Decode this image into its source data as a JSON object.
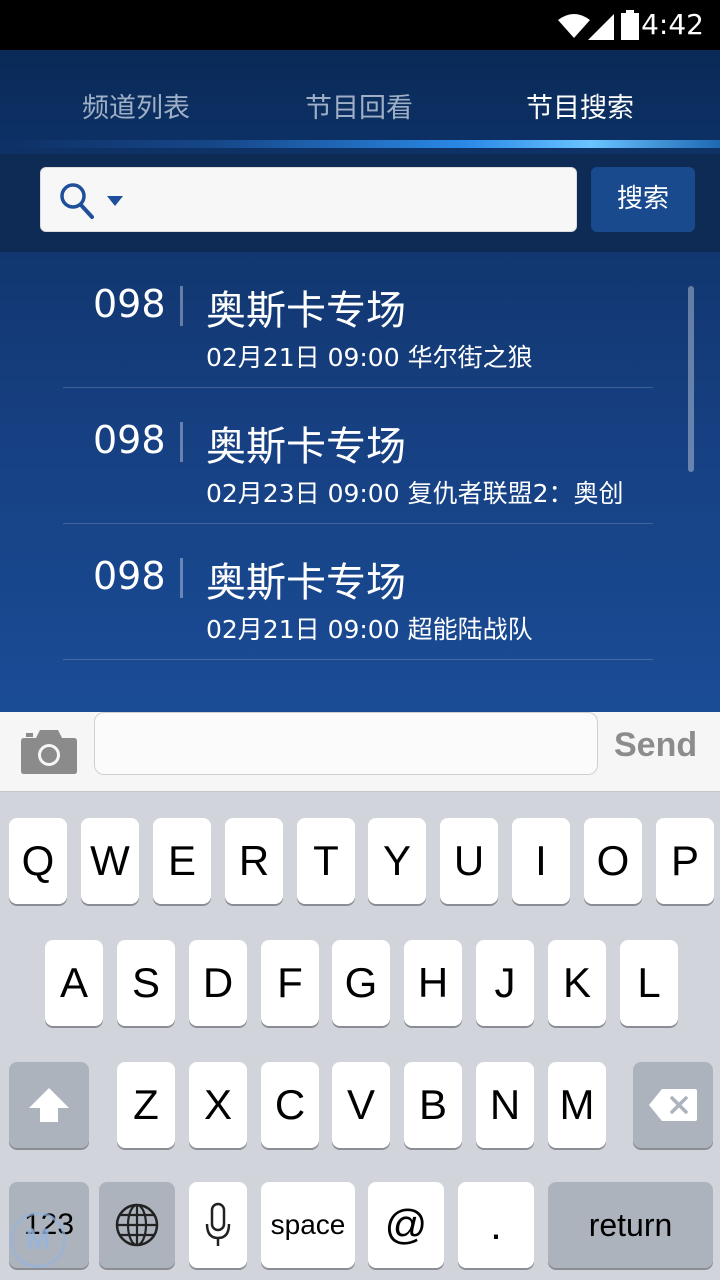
{
  "status_bar": {
    "time": "4:42",
    "icons": [
      "wifi-icon",
      "signal-icon",
      "battery-icon"
    ]
  },
  "tabs": [
    {
      "label": "频道列表",
      "active": false
    },
    {
      "label": "节目回看",
      "active": false
    },
    {
      "label": "节目搜索",
      "active": true
    }
  ],
  "search": {
    "value": "",
    "placeholder": "",
    "button_label": "搜索",
    "icon": "search-icon"
  },
  "results": [
    {
      "channel": "098",
      "title": "奥斯卡专场",
      "subtitle": "02月21日 09:00 华尔街之狼"
    },
    {
      "channel": "098",
      "title": "奥斯卡专场",
      "subtitle": "02月23日 09:00 复仇者联盟2：奥创"
    },
    {
      "channel": "098",
      "title": "奥斯卡专场",
      "subtitle": "02月21日 09:00 超能陆战队"
    }
  ],
  "message_bar": {
    "send_label": "Send",
    "camera_icon": "camera-icon"
  },
  "keyboard": {
    "row1": [
      "Q",
      "W",
      "E",
      "R",
      "T",
      "Y",
      "U",
      "I",
      "O",
      "P"
    ],
    "row2": [
      "A",
      "S",
      "D",
      "F",
      "G",
      "H",
      "J",
      "K",
      "L"
    ],
    "row3": [
      "Z",
      "X",
      "C",
      "V",
      "B",
      "N",
      "M"
    ],
    "numbers_label": "123",
    "space_label": "space",
    "at_label": "@",
    "dot_label": ".",
    "return_label": "return"
  },
  "colors": {
    "accent": "#1a4a8e",
    "tab_glow": "#6ac4ff",
    "active_tab": "#ffffff",
    "inactive_tab": "#9fb0c6"
  }
}
